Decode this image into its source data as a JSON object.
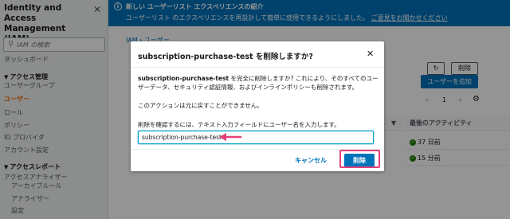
{
  "sidebar": {
    "title": "Identity and Access Management (IAM)",
    "close": "✕",
    "search_placeholder": "IAM の検索",
    "items": [
      {
        "label": "ダッシュボード"
      },
      {
        "label": "ユーザーグループ"
      },
      {
        "label": "ユーザー"
      },
      {
        "label": "ロール"
      },
      {
        "label": "ポリシー"
      },
      {
        "label": "ID プロバイダ"
      },
      {
        "label": "アカウント設定"
      },
      {
        "label": "アクセスアナライザー"
      },
      {
        "label": "アーカイブルール"
      },
      {
        "label": "アナライザー"
      },
      {
        "label": "設定"
      }
    ],
    "sections": [
      {
        "label": "アクセス管理"
      },
      {
        "label": "アクセスレポート"
      }
    ]
  },
  "banner": {
    "title": "新しい ユーザーリスト エクスペリエンスの紹介",
    "description": "ユーザーリスト のエクスペリエンスを再設計して簡単に使用できるようにしました。",
    "link": "ご意見をお聞かせください",
    "close": "✕"
  },
  "main": {
    "breadcrumb": "IAM › ユーザー",
    "delete_button": "削除",
    "add_user_button": "ユーザーを追加",
    "page_number": "1",
    "column_last_activity": "最後のアクティビティ",
    "rows": [
      {
        "last_activity": "37 日前"
      },
      {
        "last_activity": "15 分前"
      }
    ]
  },
  "modal": {
    "title": "subscription-purchase-test を削除しますか?",
    "close": "✕",
    "body_name": "subscription-purchase-test",
    "body_text": " を完全に削除しますか? これにより、そのすべてのユーザーデータ、セキュリティ認証情報、およびインラインポリシーも削除されます。",
    "irreversible": "このアクションは元に戻すことができません。",
    "confirm_prompt": "削除を確認するには、テキスト入力フィールドにユーザー名を入力します。",
    "input_value": "subscription-purchase-test",
    "cancel_label": "キャンセル",
    "delete_label": "削除"
  },
  "colors": {
    "banner": "#0073bb",
    "primary": "#0073bb",
    "active_nav": "#ec7211",
    "annotation": "#e3407a"
  }
}
